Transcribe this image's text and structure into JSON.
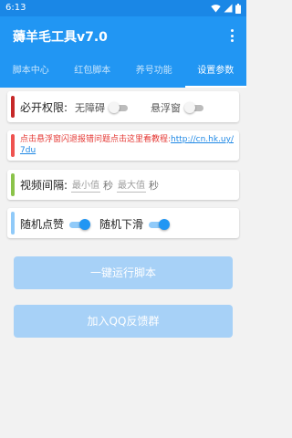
{
  "status_bar": {
    "time": "6:13"
  },
  "app_bar": {
    "title": "薅羊毛工具v7.0",
    "menu_icon": "more-vert-icon"
  },
  "tabs": [
    {
      "label": "脚本中心",
      "active": false
    },
    {
      "label": "红包脚本",
      "active": false
    },
    {
      "label": "养号功能",
      "active": false
    },
    {
      "label": "设置参数",
      "active": true
    }
  ],
  "permissions": {
    "title": "必开权限:",
    "accessibility_label": "无障碍",
    "accessibility_on": false,
    "overlay_label": "悬浮窗",
    "overlay_on": false
  },
  "notice": {
    "text": "点击悬浮窗闪退报错问题点击这里看教程:",
    "link": "http://cn.hk.uy/7du"
  },
  "video_interval": {
    "label": "视频间隔:",
    "min_placeholder": "最小值",
    "max_placeholder": "最大值",
    "unit": "秒"
  },
  "random": {
    "like_label": "随机点赞",
    "like_on": true,
    "swipe_label": "随机下滑",
    "swipe_on": true
  },
  "buttons": {
    "run": "一键运行脚本",
    "join_group": "加入QQ反馈群"
  },
  "colors": {
    "primary": "#2196f3",
    "stripe_red": "#c62828",
    "stripe_pink": "#ef5350",
    "stripe_green": "#8bc34a",
    "stripe_blue": "#90caf9",
    "notice_text": "#e53935",
    "link": "#1e88e5",
    "button_disabled": "#a7d1f7"
  }
}
